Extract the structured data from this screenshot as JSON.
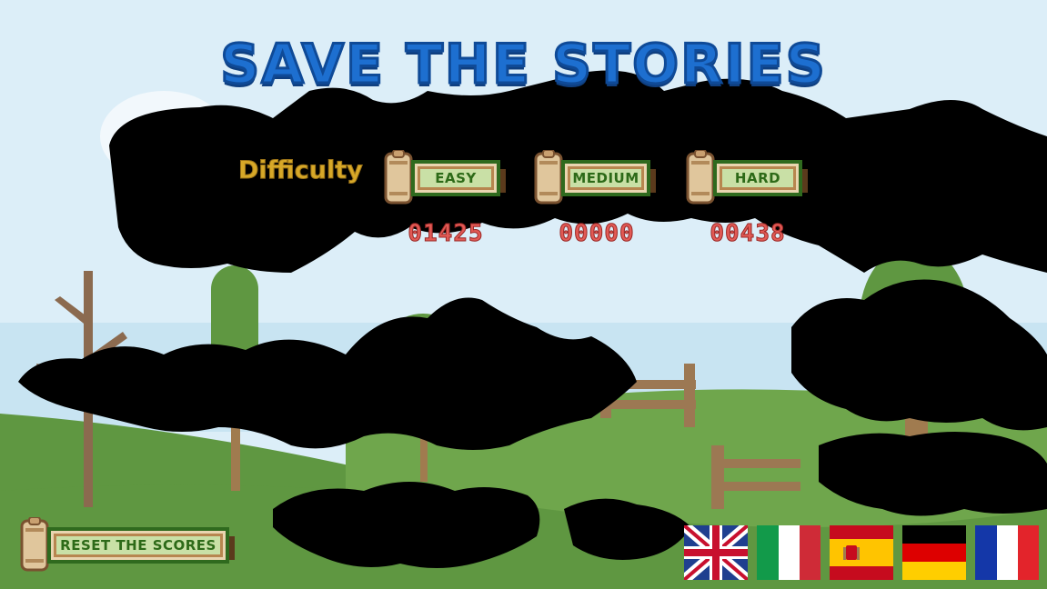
{
  "game": {
    "title": "SAVE THE STORIES",
    "difficulty_label": "Difficulty",
    "buttons": {
      "easy": "EASY",
      "medium": "MEDIUM",
      "hard": "HARD",
      "reset": "RESET THE SCORES"
    },
    "scores": {
      "easy": "01425",
      "medium": "00000",
      "hard": "00438"
    },
    "languages": [
      "english-flag",
      "italian-flag",
      "spanish-flag",
      "german-flag",
      "french-flag"
    ]
  },
  "colors": {
    "sky": "#dceef8",
    "title": "#1d6fd0",
    "label": "#d7a828",
    "score": "#e25a55",
    "button_text": "#2d6a18",
    "grass": "#5f9741"
  }
}
